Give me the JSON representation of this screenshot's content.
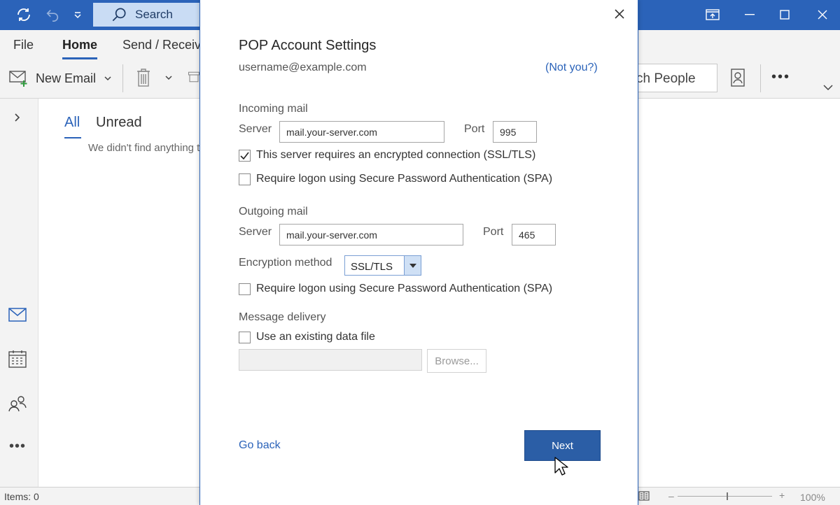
{
  "titlebar": {
    "search_label": "Search"
  },
  "ribbon_tabs": {
    "file": "File",
    "home": "Home",
    "send_receive": "Send / Receiv"
  },
  "ribbon": {
    "new_email": "New Email",
    "search_people": "ch People"
  },
  "mail_list": {
    "tab_all": "All",
    "tab_unread": "Unread",
    "empty_message": "We didn't find anything t"
  },
  "statusbar": {
    "items": "Items: 0",
    "zoom": "100%"
  },
  "dialog": {
    "title": "POP Account Settings",
    "email": "username@example.com",
    "not_you": "(Not you?)",
    "incoming": {
      "heading": "Incoming mail",
      "server_label": "Server",
      "server_value": "mail.your-server.com",
      "port_label": "Port",
      "port_value": "995",
      "ssl_checkbox": "This server requires an encrypted connection (SSL/TLS)",
      "ssl_checked": true,
      "spa_checkbox": "Require logon using Secure Password Authentication (SPA)",
      "spa_checked": false
    },
    "outgoing": {
      "heading": "Outgoing mail",
      "server_label": "Server",
      "server_value": "mail.your-server.com",
      "port_label": "Port",
      "port_value": "465",
      "encryption_label": "Encryption method",
      "encryption_value": "SSL/TLS",
      "spa_checkbox": "Require logon using Secure Password Authentication (SPA)",
      "spa_checked": false
    },
    "delivery": {
      "heading": "Message delivery",
      "existing_file_checkbox": "Use an existing data file",
      "existing_file_checked": false,
      "data_file_value": "",
      "browse_label": "Browse..."
    },
    "go_back": "Go back",
    "next": "Next"
  },
  "colors": {
    "accent": "#2b63b9",
    "next_button": "#2b5ea6"
  }
}
